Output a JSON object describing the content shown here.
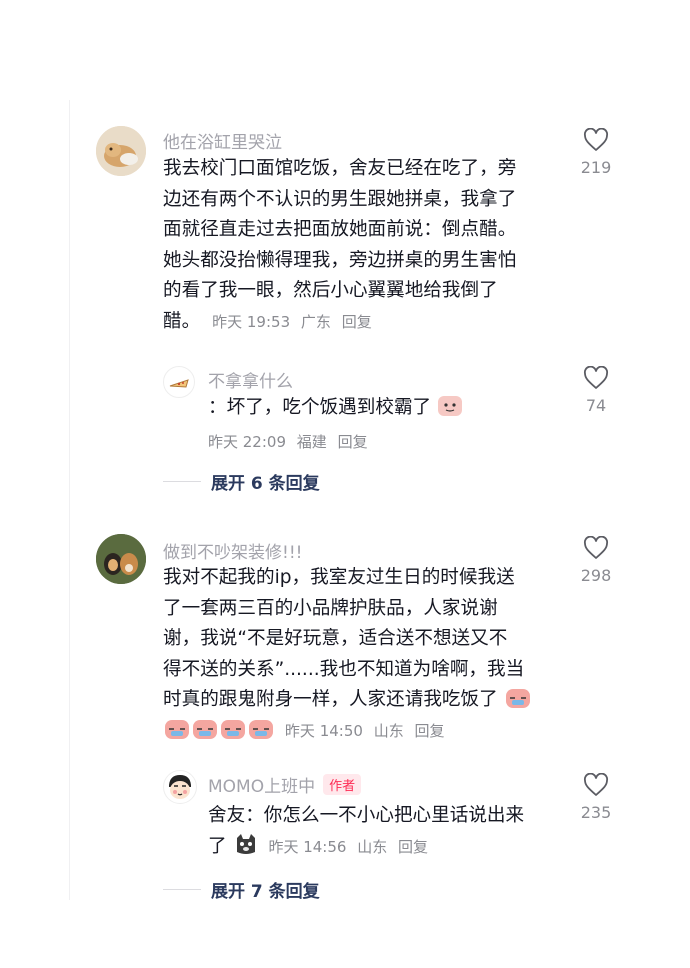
{
  "comments": [
    {
      "username": "他在浴缸里哭泣",
      "lines": [
        "我去校门口面馆吃饭，舍友已经在吃了，旁",
        "边还有两个不认识的男生跟她拼桌，我拿了",
        "面就径直走过去把面放她面前说：倒点醋。",
        "她头都没抬懒得理我，旁边拼桌的男生害怕",
        "的看了我一眼，然后小心翼翼地给我倒了",
        "醋。"
      ],
      "time": "昨天 19:53",
      "location": "广东",
      "reply_label": "回复",
      "likes": "219",
      "avatar_icon": "cat-avatar-icon",
      "reply": {
        "username": "不拿拿什么",
        "text": "：坏了，吃个饭遇到校霸了",
        "time": "昨天 22:09",
        "location": "福建",
        "reply_label": "回复",
        "likes": "74",
        "avatar_icon": "pizza-avatar-icon"
      },
      "expand_label": "展开 6 条回复"
    },
    {
      "username": "做到不吵架装修!!!",
      "lines": [
        "我对不起我的ip，我室友过生日的时候我送",
        "了一套两三百的小品牌护肤品，人家说谢",
        "谢，我说“不是好玩意，适合送不想送又不",
        "得不送的关系”......我也不知道为啥啊，我当",
        "时真的跟鬼附身一样，人家还请我吃饭了"
      ],
      "time": "昨天 14:50",
      "location": "山东",
      "reply_label": "回复",
      "likes": "298",
      "avatar_icon": "dogs-avatar-icon",
      "reply": {
        "username": "MOMO上班中",
        "badge": "作者",
        "lines": [
          "舍友：你怎么一不小心把心里话说出来",
          "了"
        ],
        "time": "昨天 14:56",
        "location": "山东",
        "reply_label": "回复",
        "likes": "235",
        "avatar_icon": "cartoon-boy-avatar-icon"
      },
      "expand_label": "展开 7 条回复"
    }
  ],
  "colors": {
    "text": "#161823",
    "secondary": "#8a8b91",
    "username": "#a3a3ab",
    "expand": "#2b3a5e",
    "author_badge": "#fe2c55"
  }
}
